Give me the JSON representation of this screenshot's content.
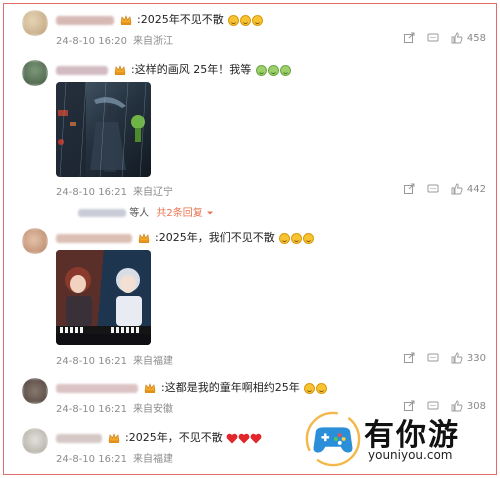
{
  "comments": [
    {
      "text": ":2025年不见不散",
      "date": "24-8-10 16:20",
      "location": "来自浙江",
      "likes": "458",
      "emojis": [
        "yellow",
        "yellow",
        "yellow"
      ]
    },
    {
      "text": ":这样的画风 25年！我等",
      "date": "24-8-10 16:21",
      "location": "来自辽宁",
      "likes": "442",
      "emojis": [
        "green",
        "green",
        "green"
      ],
      "reply": {
        "suffix": "等人",
        "more": "共2条回复"
      }
    },
    {
      "text": ":2025年，我们不见不散",
      "date": "24-8-10 16:21",
      "location": "来自福建",
      "likes": "330",
      "emojis": [
        "yellow",
        "yellow",
        "yellow"
      ]
    },
    {
      "text": ":这都是我的童年啊相约25年",
      "date": "24-8-10 16:21",
      "location": "来自安徽",
      "likes": "308",
      "emojis": [
        "yellow",
        "yellow"
      ]
    },
    {
      "text": ":2025年，不见不散",
      "date": "24-8-10 16:21",
      "location": "来自福建",
      "likes": "",
      "emojis": []
    }
  ],
  "watermark": {
    "name": "有你游",
    "url": "youniyou.com"
  },
  "colors": {
    "border": "#e36a6a",
    "accent": "#eb7350",
    "meta": "#8c8c8c"
  }
}
